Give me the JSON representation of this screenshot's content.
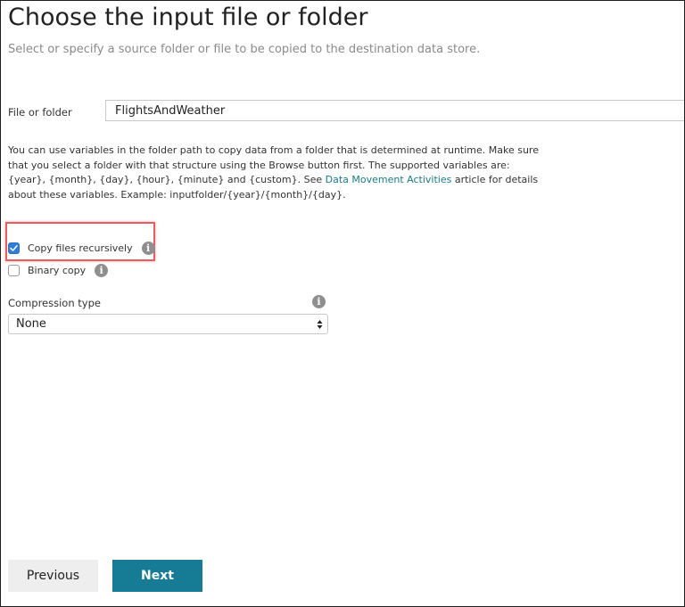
{
  "page": {
    "title": "Choose the input file or folder",
    "subtitle": "Select or specify a source folder or file to be copied to the destination data store."
  },
  "file_or_folder": {
    "label": "File or folder",
    "value": "FlightsAndWeather"
  },
  "help": {
    "text_before_link": "You can use variables in the folder path to copy data from a folder that is determined at runtime. Make sure that you select a folder with that structure using the Browse button first. The supported variables are: {year}, {month}, {day}, {hour}, {minute} and {custom}. See ",
    "link_text": "Data Movement Activities",
    "text_after_link": " article for details about these variables. Example: inputfolder/{year}/{month}/{day}."
  },
  "options": {
    "copy_recursively": {
      "label": "Copy files recursively",
      "checked": true
    },
    "binary_copy": {
      "label": "Binary copy",
      "checked": false
    }
  },
  "compression": {
    "label": "Compression type",
    "selected": "None"
  },
  "icons": {
    "info": "info-icon",
    "checkmark": "checkmark-icon",
    "select_arrows": "select-arrows-icon"
  },
  "buttons": {
    "previous": "Previous",
    "next": "Next"
  },
  "colors": {
    "accent": "#167b94",
    "link": "#1a7a85",
    "checkbox_checked": "#2f7fd8",
    "highlight": "#e85d5d"
  }
}
